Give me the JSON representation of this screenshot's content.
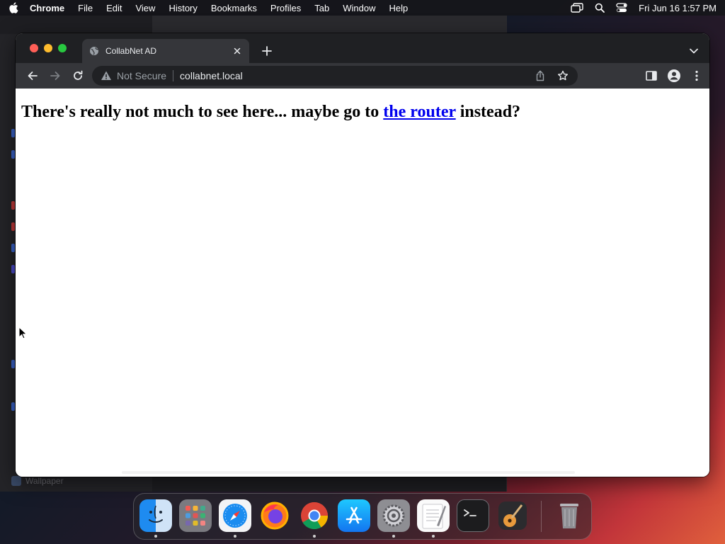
{
  "menubar": {
    "items": [
      "Chrome",
      "File",
      "Edit",
      "View",
      "History",
      "Bookmarks",
      "Profiles",
      "Tab",
      "Window",
      "Help"
    ],
    "clock": "Fri Jun 16  1:57 PM"
  },
  "background_window": {
    "footer_label": "Wallpaper"
  },
  "browser": {
    "tab": {
      "title": "CollabNet AD",
      "favicon": "globe-icon"
    },
    "omnibox": {
      "security_label": "Not Secure",
      "url": "collabnet.local"
    }
  },
  "page": {
    "text_before": "There's really not much to see here... maybe go to ",
    "link_text": "the router",
    "text_after": " instead?"
  },
  "dock": {
    "items": [
      "finder-icon",
      "launchpad-icon",
      "safari-icon",
      "firefox-icon",
      "chrome-icon",
      "app-store-icon",
      "system-settings-icon",
      "textedit-icon",
      "terminal-icon",
      "garageband-icon",
      "trash-icon"
    ]
  },
  "colors": {
    "link": "#0000ee",
    "tab_active": "#35363a",
    "tabstrip": "#1f2023"
  }
}
